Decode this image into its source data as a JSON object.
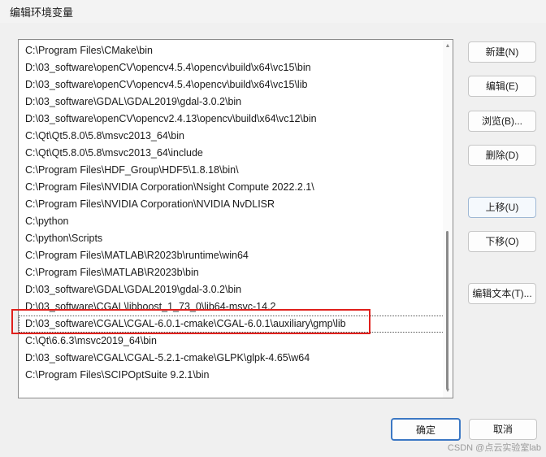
{
  "window": {
    "title": "编辑环境变量"
  },
  "path_list": {
    "items": [
      "C:\\Program Files\\CMake\\bin",
      "D:\\03_software\\openCV\\opencv4.5.4\\opencv\\build\\x64\\vc15\\bin",
      "D:\\03_software\\openCV\\opencv4.5.4\\opencv\\build\\x64\\vc15\\lib",
      "D:\\03_software\\GDAL\\GDAL2019\\gdal-3.0.2\\bin",
      "D:\\03_software\\openCV\\opencv2.4.13\\opencv\\build\\x64\\vc12\\bin",
      "C:\\Qt\\Qt5.8.0\\5.8\\msvc2013_64\\bin",
      "C:\\Qt\\Qt5.8.0\\5.8\\msvc2013_64\\include",
      "C:\\Program Files\\HDF_Group\\HDF5\\1.8.18\\bin\\",
      "C:\\Program Files\\NVIDIA Corporation\\Nsight Compute 2022.2.1\\",
      "C:\\Program Files\\NVIDIA Corporation\\NVIDIA NvDLISR",
      "C:\\python",
      "C:\\python\\Scripts",
      "C:\\Program Files\\MATLAB\\R2023b\\runtime\\win64",
      "C:\\Program Files\\MATLAB\\R2023b\\bin",
      "D:\\03_software\\GDAL\\GDAL2019\\gdal-3.0.2\\bin",
      "D:\\03_software\\CGAL\\libboost_1_73_0\\lib64-msvc-14.2",
      "D:\\03_software\\CGAL\\CGAL-6.0.1-cmake\\CGAL-6.0.1\\auxiliary\\gmp\\lib",
      "C:\\Qt\\6.6.3\\msvc2019_64\\bin",
      "D:\\03_software\\CGAL\\CGAL-5.2.1-cmake\\GLPK\\glpk-4.65\\w64",
      "C:\\Program Files\\SCIPOptSuite 9.2.1\\bin"
    ]
  },
  "buttons": {
    "new": "新建(N)",
    "edit": "编辑(E)",
    "browse": "浏览(B)...",
    "delete": "删除(D)",
    "move_up": "上移(U)",
    "move_down": "下移(O)",
    "edit_text": "编辑文本(T)...",
    "ok": "确定",
    "cancel": "取消"
  },
  "watermark": "CSDN @点云实验室lab",
  "colors": {
    "highlight_border": "#e0201c",
    "primary_button_border": "#3c78c4"
  }
}
